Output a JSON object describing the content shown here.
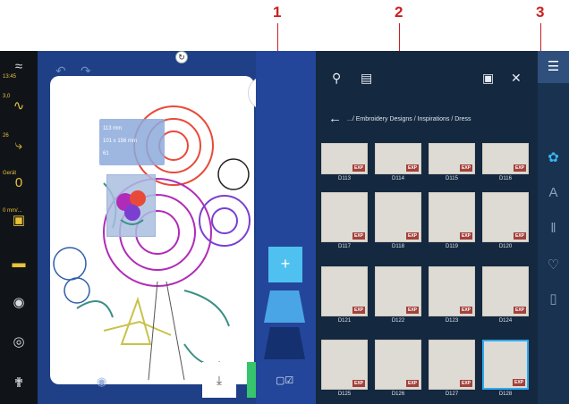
{
  "callouts": [
    "1",
    "2",
    "3"
  ],
  "status_bar": {
    "time": "13:45",
    "speed_value": "3,0",
    "stitch_value": "26",
    "thread_label": "Gerät",
    "presser_label": "0 mm/..."
  },
  "canvas": {
    "info_size": "113 mm",
    "info_dims": "101 x 156 mm",
    "info_other": "61"
  },
  "library": {
    "breadcrumb": ".../ Embroidery Designs / Inspirations / Dress",
    "tiles": [
      {
        "name": "D113",
        "badge": "EXP"
      },
      {
        "name": "D114",
        "badge": "EXP"
      },
      {
        "name": "D115",
        "badge": "EXP"
      },
      {
        "name": "D116",
        "badge": "EXP"
      },
      {
        "name": "D117",
        "badge": "EXP"
      },
      {
        "name": "D118",
        "badge": "EXP"
      },
      {
        "name": "D119",
        "badge": "EXP"
      },
      {
        "name": "D120",
        "badge": "EXP"
      },
      {
        "name": "D121",
        "badge": "EXP"
      },
      {
        "name": "D122",
        "badge": "EXP"
      },
      {
        "name": "D123",
        "badge": "EXP"
      },
      {
        "name": "D124",
        "badge": "EXP"
      },
      {
        "name": "D125",
        "badge": "EXP"
      },
      {
        "name": "D126",
        "badge": "EXP"
      },
      {
        "name": "D127",
        "badge": "EXP"
      },
      {
        "name": "D128",
        "badge": "EXP"
      }
    ]
  },
  "colors": {
    "accent_blue": "#2fa8f1",
    "ok_green": "#36c46c",
    "callout_red": "#cc1f1f",
    "badge_red": "#a3413b"
  }
}
